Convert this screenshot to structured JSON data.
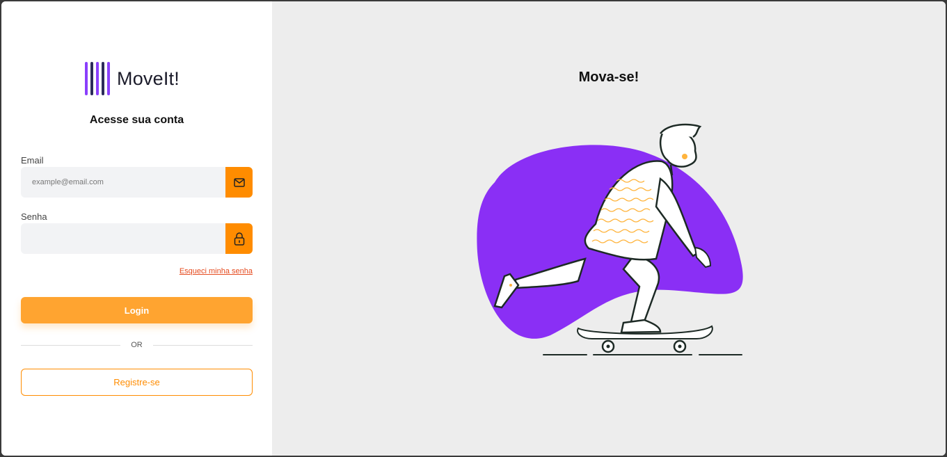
{
  "brand": {
    "name": "MoveIt!",
    "bar_colors": [
      "#8a3ffc",
      "#2c2c5a",
      "#8a3ffc",
      "#2c2c5a",
      "#8a3ffc"
    ]
  },
  "login_form": {
    "title": "Acesse sua conta",
    "email_label": "Email",
    "email_placeholder": "example@email.com",
    "email_value": "",
    "email_icon": "mail-icon",
    "password_label": "Senha",
    "password_value": "",
    "password_icon": "lock-icon",
    "forgot_link": "Esqueci minha senha",
    "login_button": "Login",
    "divider_text": "OR",
    "register_button": "Registre-se"
  },
  "hero": {
    "title": "Mova-se!",
    "illustration": "skateboarder-illustration"
  },
  "colors": {
    "accent_orange": "#ff8c00",
    "button_orange": "#ffa430",
    "link_red": "#e54b1f",
    "blob_purple": "#8a2ff5"
  }
}
